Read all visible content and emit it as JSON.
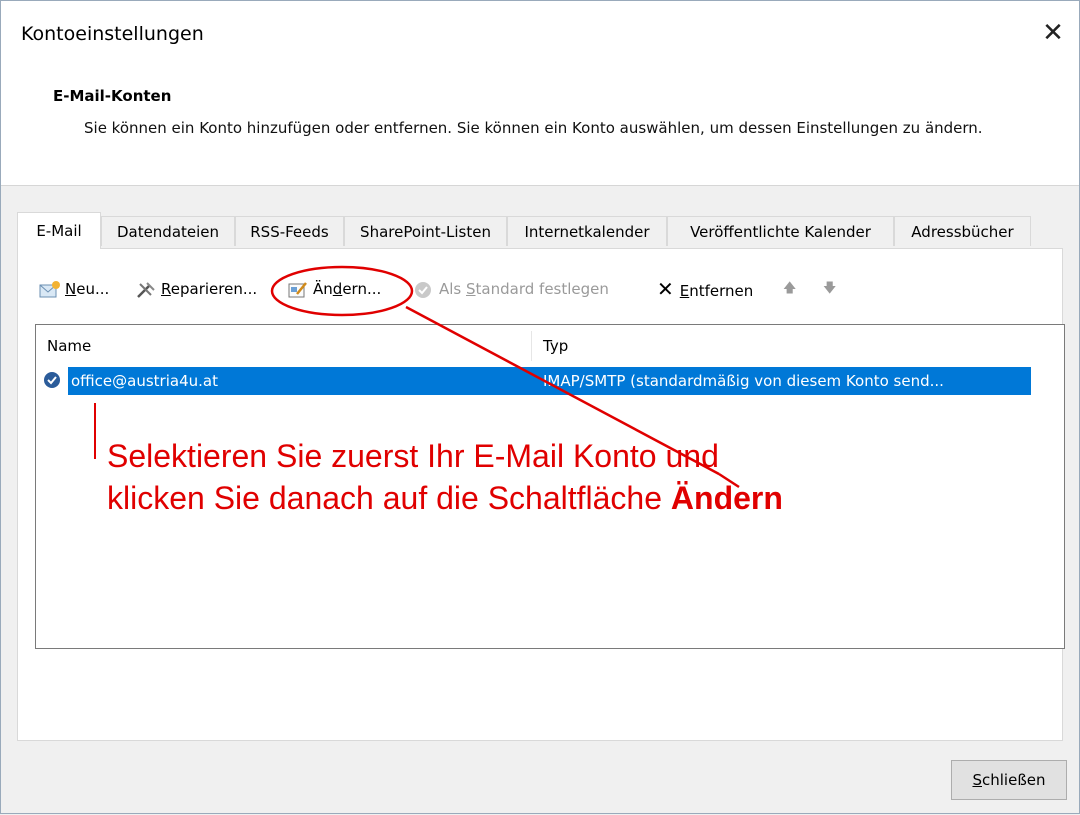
{
  "window": {
    "title": "Kontoeinstellungen"
  },
  "section": {
    "title": "E-Mail-Konten",
    "description": "Sie können ein Konto hinzufügen oder entfernen. Sie können ein Konto auswählen, um dessen Einstellungen zu ändern."
  },
  "tabs": [
    {
      "label": "E-Mail"
    },
    {
      "label": "Datendateien"
    },
    {
      "label": "RSS-Feeds"
    },
    {
      "label": "SharePoint-Listen"
    },
    {
      "label": "Internetkalender"
    },
    {
      "label": "Veröffentlichte Kalender"
    },
    {
      "label": "Adressbücher"
    }
  ],
  "toolbar": {
    "new": {
      "prefix": "",
      "mnemonic": "N",
      "suffix": "eu..."
    },
    "repair": {
      "prefix": "",
      "mnemonic": "R",
      "suffix": "eparieren..."
    },
    "change": {
      "prefix": "Än",
      "mnemonic": "d",
      "suffix": "ern..."
    },
    "default": {
      "prefix": "Als ",
      "mnemonic": "S",
      "suffix": "tandard festlegen"
    },
    "remove": {
      "prefix": "",
      "mnemonic": "E",
      "suffix": "ntfernen"
    }
  },
  "accounts_table": {
    "columns": [
      "Name",
      "Typ"
    ],
    "rows": [
      {
        "name": "office@austria4u.at",
        "type": "IMAP/SMTP (standardmäßig von diesem Konto send..."
      }
    ]
  },
  "annotation": {
    "line1": "Selektieren Sie zuerst Ihr E-Mail Konto und",
    "line2_text": "klicken Sie danach auf die Schaltfläche ",
    "line2_bold": "Ändern"
  },
  "footer": {
    "close": {
      "mnemonic": "S",
      "suffix": "chließen"
    }
  },
  "colors": {
    "selection": "#0078d7",
    "annotation": "#e00000"
  }
}
